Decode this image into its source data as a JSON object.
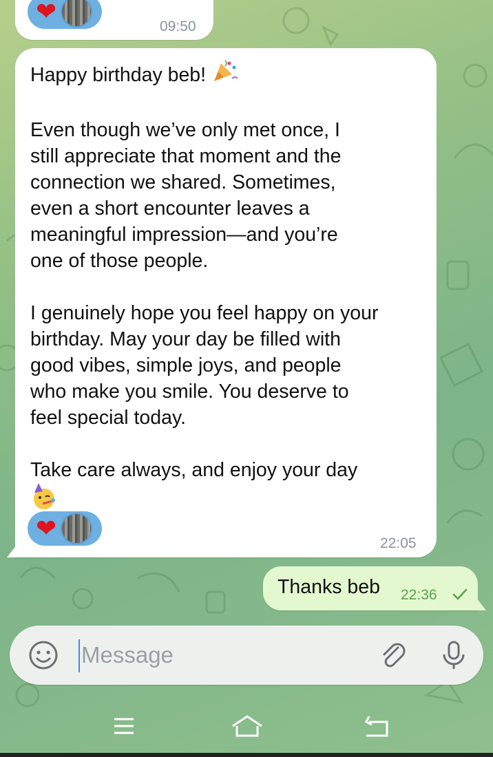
{
  "chat": {
    "prev_message": {
      "reactions": [
        "heart",
        "avatar"
      ],
      "time": "09:50"
    },
    "main_message": {
      "text_line1": "Happy birthday beb! ",
      "text_body": "Even though we’ve only met once, I\nstill appreciate that moment and the\nconnection we shared. Sometimes,\neven a short encounter leaves a\nmeaningful impression—and you’re\none of those people.\n\nI genuinely hope you feel happy on your\nbirthday. May your day be filled with\ngood vibes, simple joys, and people\nwho make you smile. You deserve to\nfeel special today.\n\nTake care always, and enjoy your day",
      "emoji_1": "party-popper",
      "emoji_2": "partying-face",
      "reactions": [
        "heart",
        "avatar"
      ],
      "time": "22:05"
    },
    "reply_message": {
      "text": "Thanks beb",
      "time": "22:36",
      "status": "sent-check"
    }
  },
  "composer": {
    "placeholder": "Message"
  },
  "colors": {
    "reaction_bg": "#6fb0e3",
    "outgoing_bg": "#e3f8cf",
    "accent": "#3d8ee0"
  },
  "icons": [
    "emoji-icon",
    "attach-icon",
    "mic-icon",
    "menu-icon",
    "home-icon",
    "back-icon"
  ]
}
